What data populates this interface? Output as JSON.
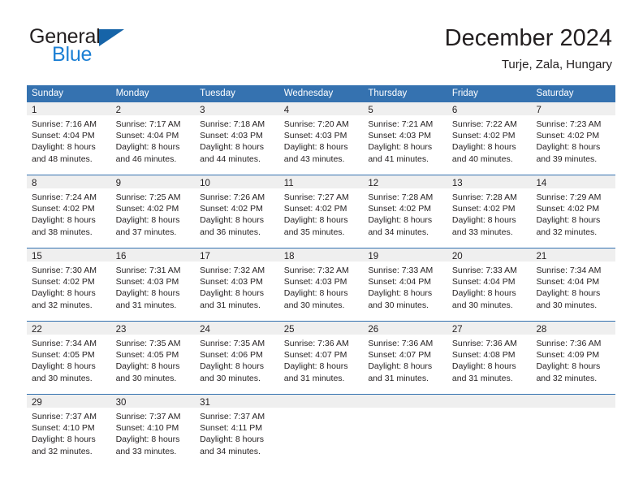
{
  "brand": {
    "name_primary": "General",
    "name_secondary": "Blue",
    "accent_color": "#1b7fd4",
    "triangle_color": "#1664a8",
    "logo_icon": "triangle-right-icon"
  },
  "header": {
    "month_title": "December 2024",
    "location": "Turje, Zala, Hungary"
  },
  "calendar": {
    "header_bg": "#3572b0",
    "day_band_bg": "#efefef",
    "weekdays": [
      "Sunday",
      "Monday",
      "Tuesday",
      "Wednesday",
      "Thursday",
      "Friday",
      "Saturday"
    ],
    "weeks": [
      [
        {
          "day": "1",
          "sunrise": "Sunrise: 7:16 AM",
          "sunset": "Sunset: 4:04 PM",
          "daylight_line1": "Daylight: 8 hours",
          "daylight_line2": "and 48 minutes."
        },
        {
          "day": "2",
          "sunrise": "Sunrise: 7:17 AM",
          "sunset": "Sunset: 4:04 PM",
          "daylight_line1": "Daylight: 8 hours",
          "daylight_line2": "and 46 minutes."
        },
        {
          "day": "3",
          "sunrise": "Sunrise: 7:18 AM",
          "sunset": "Sunset: 4:03 PM",
          "daylight_line1": "Daylight: 8 hours",
          "daylight_line2": "and 44 minutes."
        },
        {
          "day": "4",
          "sunrise": "Sunrise: 7:20 AM",
          "sunset": "Sunset: 4:03 PM",
          "daylight_line1": "Daylight: 8 hours",
          "daylight_line2": "and 43 minutes."
        },
        {
          "day": "5",
          "sunrise": "Sunrise: 7:21 AM",
          "sunset": "Sunset: 4:03 PM",
          "daylight_line1": "Daylight: 8 hours",
          "daylight_line2": "and 41 minutes."
        },
        {
          "day": "6",
          "sunrise": "Sunrise: 7:22 AM",
          "sunset": "Sunset: 4:02 PM",
          "daylight_line1": "Daylight: 8 hours",
          "daylight_line2": "and 40 minutes."
        },
        {
          "day": "7",
          "sunrise": "Sunrise: 7:23 AM",
          "sunset": "Sunset: 4:02 PM",
          "daylight_line1": "Daylight: 8 hours",
          "daylight_line2": "and 39 minutes."
        }
      ],
      [
        {
          "day": "8",
          "sunrise": "Sunrise: 7:24 AM",
          "sunset": "Sunset: 4:02 PM",
          "daylight_line1": "Daylight: 8 hours",
          "daylight_line2": "and 38 minutes."
        },
        {
          "day": "9",
          "sunrise": "Sunrise: 7:25 AM",
          "sunset": "Sunset: 4:02 PM",
          "daylight_line1": "Daylight: 8 hours",
          "daylight_line2": "and 37 minutes."
        },
        {
          "day": "10",
          "sunrise": "Sunrise: 7:26 AM",
          "sunset": "Sunset: 4:02 PM",
          "daylight_line1": "Daylight: 8 hours",
          "daylight_line2": "and 36 minutes."
        },
        {
          "day": "11",
          "sunrise": "Sunrise: 7:27 AM",
          "sunset": "Sunset: 4:02 PM",
          "daylight_line1": "Daylight: 8 hours",
          "daylight_line2": "and 35 minutes."
        },
        {
          "day": "12",
          "sunrise": "Sunrise: 7:28 AM",
          "sunset": "Sunset: 4:02 PM",
          "daylight_line1": "Daylight: 8 hours",
          "daylight_line2": "and 34 minutes."
        },
        {
          "day": "13",
          "sunrise": "Sunrise: 7:28 AM",
          "sunset": "Sunset: 4:02 PM",
          "daylight_line1": "Daylight: 8 hours",
          "daylight_line2": "and 33 minutes."
        },
        {
          "day": "14",
          "sunrise": "Sunrise: 7:29 AM",
          "sunset": "Sunset: 4:02 PM",
          "daylight_line1": "Daylight: 8 hours",
          "daylight_line2": "and 32 minutes."
        }
      ],
      [
        {
          "day": "15",
          "sunrise": "Sunrise: 7:30 AM",
          "sunset": "Sunset: 4:02 PM",
          "daylight_line1": "Daylight: 8 hours",
          "daylight_line2": "and 32 minutes."
        },
        {
          "day": "16",
          "sunrise": "Sunrise: 7:31 AM",
          "sunset": "Sunset: 4:03 PM",
          "daylight_line1": "Daylight: 8 hours",
          "daylight_line2": "and 31 minutes."
        },
        {
          "day": "17",
          "sunrise": "Sunrise: 7:32 AM",
          "sunset": "Sunset: 4:03 PM",
          "daylight_line1": "Daylight: 8 hours",
          "daylight_line2": "and 31 minutes."
        },
        {
          "day": "18",
          "sunrise": "Sunrise: 7:32 AM",
          "sunset": "Sunset: 4:03 PM",
          "daylight_line1": "Daylight: 8 hours",
          "daylight_line2": "and 30 minutes."
        },
        {
          "day": "19",
          "sunrise": "Sunrise: 7:33 AM",
          "sunset": "Sunset: 4:04 PM",
          "daylight_line1": "Daylight: 8 hours",
          "daylight_line2": "and 30 minutes."
        },
        {
          "day": "20",
          "sunrise": "Sunrise: 7:33 AM",
          "sunset": "Sunset: 4:04 PM",
          "daylight_line1": "Daylight: 8 hours",
          "daylight_line2": "and 30 minutes."
        },
        {
          "day": "21",
          "sunrise": "Sunrise: 7:34 AM",
          "sunset": "Sunset: 4:04 PM",
          "daylight_line1": "Daylight: 8 hours",
          "daylight_line2": "and 30 minutes."
        }
      ],
      [
        {
          "day": "22",
          "sunrise": "Sunrise: 7:34 AM",
          "sunset": "Sunset: 4:05 PM",
          "daylight_line1": "Daylight: 8 hours",
          "daylight_line2": "and 30 minutes."
        },
        {
          "day": "23",
          "sunrise": "Sunrise: 7:35 AM",
          "sunset": "Sunset: 4:05 PM",
          "daylight_line1": "Daylight: 8 hours",
          "daylight_line2": "and 30 minutes."
        },
        {
          "day": "24",
          "sunrise": "Sunrise: 7:35 AM",
          "sunset": "Sunset: 4:06 PM",
          "daylight_line1": "Daylight: 8 hours",
          "daylight_line2": "and 30 minutes."
        },
        {
          "day": "25",
          "sunrise": "Sunrise: 7:36 AM",
          "sunset": "Sunset: 4:07 PM",
          "daylight_line1": "Daylight: 8 hours",
          "daylight_line2": "and 31 minutes."
        },
        {
          "day": "26",
          "sunrise": "Sunrise: 7:36 AM",
          "sunset": "Sunset: 4:07 PM",
          "daylight_line1": "Daylight: 8 hours",
          "daylight_line2": "and 31 minutes."
        },
        {
          "day": "27",
          "sunrise": "Sunrise: 7:36 AM",
          "sunset": "Sunset: 4:08 PM",
          "daylight_line1": "Daylight: 8 hours",
          "daylight_line2": "and 31 minutes."
        },
        {
          "day": "28",
          "sunrise": "Sunrise: 7:36 AM",
          "sunset": "Sunset: 4:09 PM",
          "daylight_line1": "Daylight: 8 hours",
          "daylight_line2": "and 32 minutes."
        }
      ],
      [
        {
          "day": "29",
          "sunrise": "Sunrise: 7:37 AM",
          "sunset": "Sunset: 4:10 PM",
          "daylight_line1": "Daylight: 8 hours",
          "daylight_line2": "and 32 minutes."
        },
        {
          "day": "30",
          "sunrise": "Sunrise: 7:37 AM",
          "sunset": "Sunset: 4:10 PM",
          "daylight_line1": "Daylight: 8 hours",
          "daylight_line2": "and 33 minutes."
        },
        {
          "day": "31",
          "sunrise": "Sunrise: 7:37 AM",
          "sunset": "Sunset: 4:11 PM",
          "daylight_line1": "Daylight: 8 hours",
          "daylight_line2": "and 34 minutes."
        },
        {
          "day": "",
          "sunrise": "",
          "sunset": "",
          "daylight_line1": "",
          "daylight_line2": ""
        },
        {
          "day": "",
          "sunrise": "",
          "sunset": "",
          "daylight_line1": "",
          "daylight_line2": ""
        },
        {
          "day": "",
          "sunrise": "",
          "sunset": "",
          "daylight_line1": "",
          "daylight_line2": ""
        },
        {
          "day": "",
          "sunrise": "",
          "sunset": "",
          "daylight_line1": "",
          "daylight_line2": ""
        }
      ]
    ]
  }
}
